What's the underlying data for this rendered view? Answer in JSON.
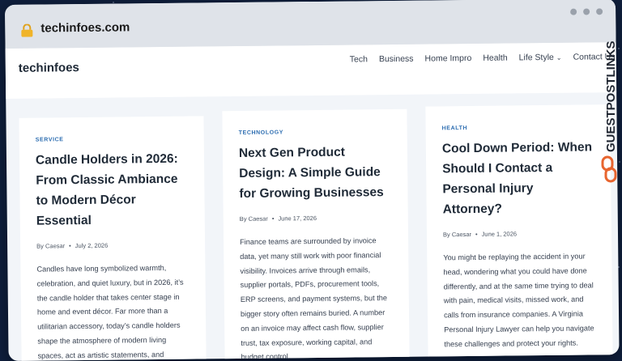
{
  "browser": {
    "url": "techinfoes.com"
  },
  "site": {
    "logo": "techinfoes",
    "nav": {
      "tech": "Tech",
      "business": "Business",
      "home": "Home Impro",
      "health": "Health",
      "life": "Life Style",
      "contact": "Contact Us"
    }
  },
  "watermark": "GUESTPOSTLINKS",
  "cards": [
    {
      "category": "SERVICE",
      "title": "Candle Holders in 2026: From Classic Ambiance to Modern Décor Essential",
      "author": "By Caesar",
      "date": "July 2, 2026",
      "excerpt": "Candles have long symbolized warmth, celebration, and quiet luxury, but in 2026, it’s the candle holder that takes center stage in home and event décor. Far more than a utilitarian accessory, today’s candle holders shape the atmosphere of modern living spaces, act as artistic statements, and support"
    },
    {
      "category": "TECHNOLOGY",
      "title": "Next Gen Product Design: A Simple Guide for Growing Businesses",
      "author": "By Caesar",
      "date": "June 17, 2026",
      "excerpt": "Finance teams are surrounded by invoice data, yet many still work with poor financial visibility. Invoices arrive through emails, supplier portals, PDFs, procurement tools, ERP screens, and payment systems, but the bigger story often remains buried. A number on an invoice may affect cash flow, supplier trust, tax exposure, working capital, and budget control."
    },
    {
      "category": "HEALTH",
      "title": "Cool Down Period: When Should I Contact a Personal Injury Attorney?",
      "author": "By Caesar",
      "date": "June 1, 2026",
      "excerpt": "You might be replaying the accident in your head, wondering what you could have done differently, and at the same time trying to deal with pain, medical visits, missed work, and calls from insurance companies. A Virginia Personal Injury Lawyer can help you navigate these challenges and protect your rights."
    }
  ]
}
